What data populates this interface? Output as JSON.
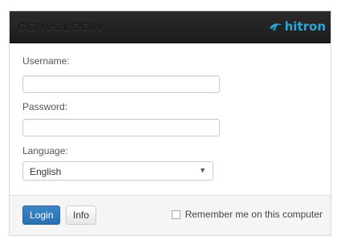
{
  "header": {
    "title": "CGNV5 LOGIN",
    "logo_text": "hitron",
    "logo_color": "#2aa6d8"
  },
  "form": {
    "username": {
      "label": "Username:",
      "value": "",
      "placeholder": ""
    },
    "password": {
      "label": "Password:",
      "value": "",
      "placeholder": ""
    },
    "language": {
      "label": "Language:",
      "selected": "English",
      "arrow_icon": "caret-down-icon"
    }
  },
  "footer": {
    "login_label": "Login",
    "info_label": "Info",
    "remember_label": "Remember me on this computer",
    "remember_checked": false
  },
  "colors": {
    "header_bg": "#222222",
    "login_button": "#2f7dc0",
    "footer_bg": "#f5f5f5"
  }
}
